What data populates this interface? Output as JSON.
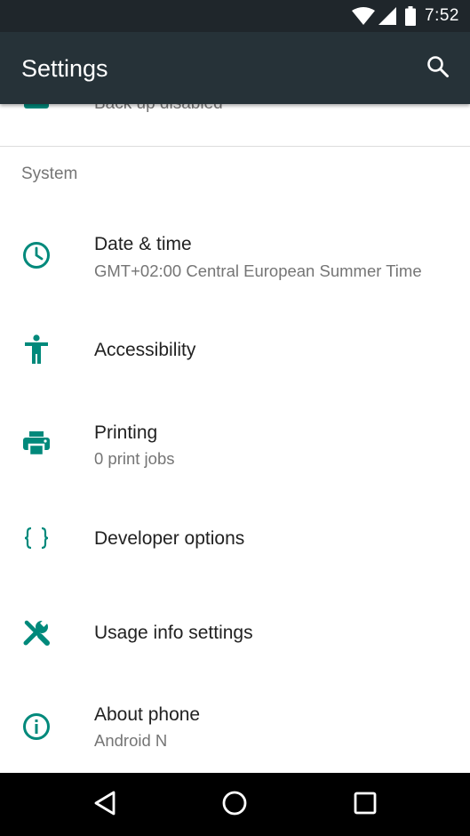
{
  "status_bar": {
    "time": "7:52",
    "icons": [
      "wifi-icon",
      "signal-icon",
      "battery-icon"
    ]
  },
  "app_bar": {
    "title": "Settings",
    "search_icon": "search-icon"
  },
  "previous_item": {
    "subtitle": "Back up disabled",
    "icon": "backup-icon"
  },
  "system_section": {
    "header": "System",
    "items": [
      {
        "title": "Date & time",
        "subtitle": "GMT+02:00 Central European Summer Time",
        "icon": "clock-icon"
      },
      {
        "title": "Accessibility",
        "icon": "accessibility-icon"
      },
      {
        "title": "Printing",
        "subtitle": "0 print jobs",
        "icon": "printer-icon"
      },
      {
        "title": "Developer options",
        "icon": "braces-icon"
      },
      {
        "title": "Usage info settings",
        "icon": "wrench-icon"
      },
      {
        "title": "About phone",
        "subtitle": "Android N",
        "icon": "info-icon"
      }
    ]
  },
  "nav_bar": {
    "back_icon": "back-icon",
    "home_icon": "home-icon",
    "recents_icon": "recents-icon"
  },
  "colors": {
    "accent": "#00897b",
    "app_bar": "#263238",
    "status_bar": "#1f262b",
    "primary_text": "#212121",
    "secondary_text": "#757575"
  }
}
